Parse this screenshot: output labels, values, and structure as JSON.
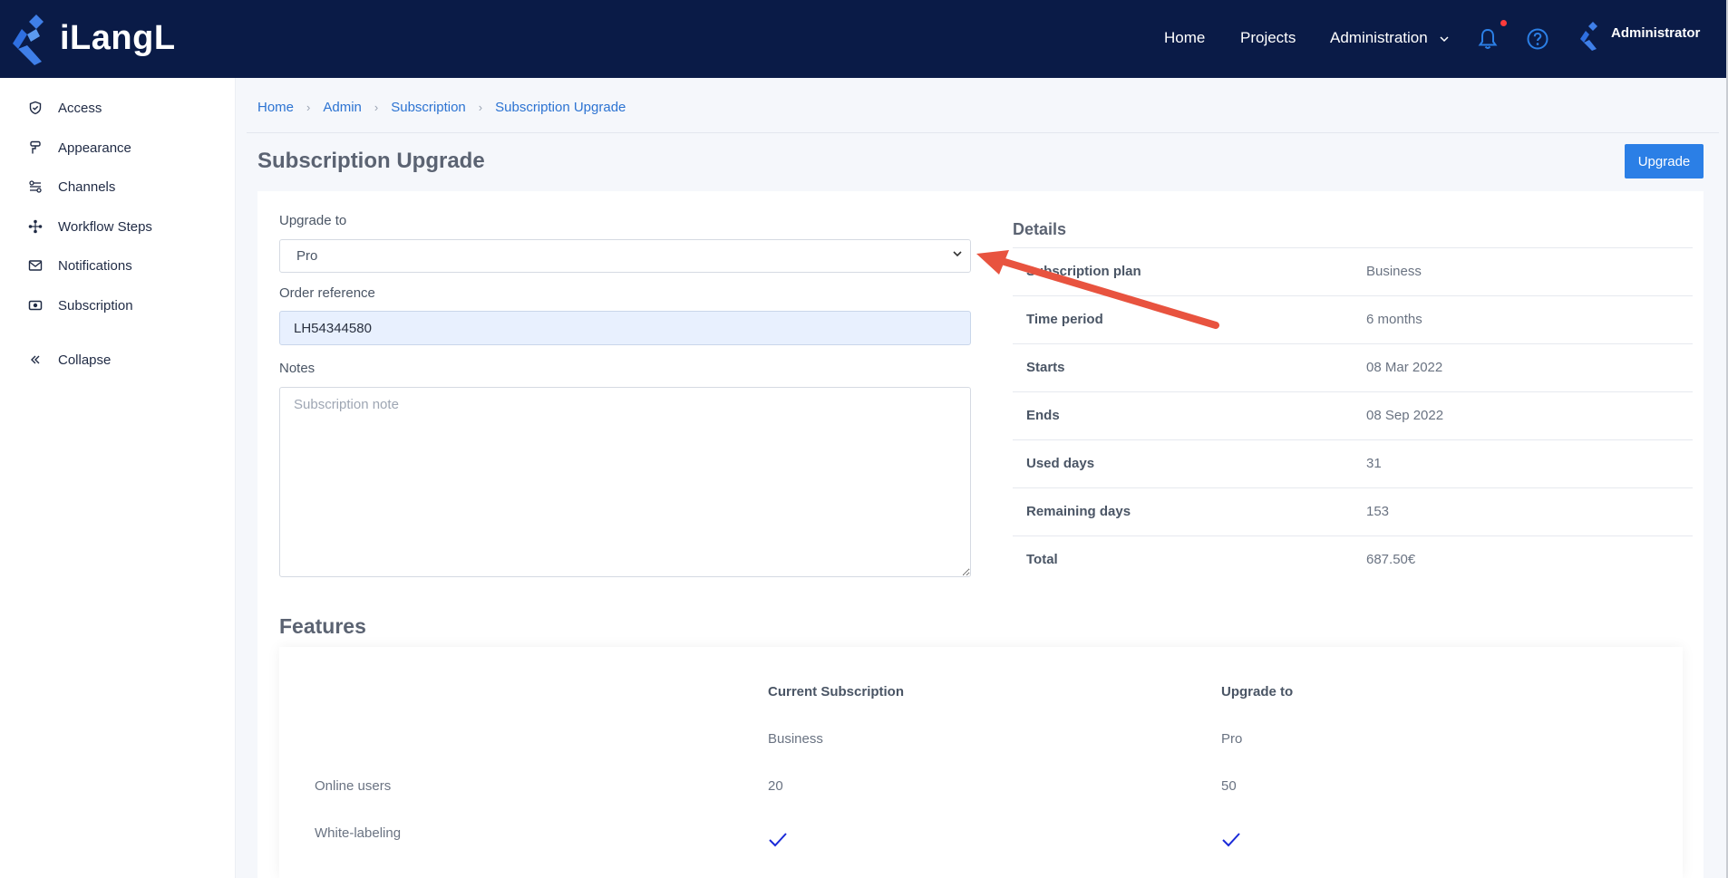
{
  "brand": {
    "name": "iLangL"
  },
  "topnav": {
    "home": "Home",
    "projects": "Projects",
    "administration": "Administration",
    "user_name": "Administrator"
  },
  "sidebar": {
    "items": [
      {
        "label": "Access",
        "icon": "shield-icon"
      },
      {
        "label": "Appearance",
        "icon": "paint-roller-icon"
      },
      {
        "label": "Channels",
        "icon": "channels-icon"
      },
      {
        "label": "Workflow Steps",
        "icon": "workflow-icon"
      },
      {
        "label": "Notifications",
        "icon": "mail-icon"
      },
      {
        "label": "Subscription",
        "icon": "subscription-icon"
      }
    ],
    "collapse": "Collapse"
  },
  "breadcrumb": [
    "Home",
    "Admin",
    "Subscription",
    "Subscription Upgrade"
  ],
  "page": {
    "title": "Subscription Upgrade",
    "upgrade_button": "Upgrade"
  },
  "form": {
    "upgrade_to_label": "Upgrade to",
    "upgrade_to_value": "Pro",
    "order_reference_label": "Order reference",
    "order_reference_value": "LH54344580",
    "notes_label": "Notes",
    "notes_placeholder": "Subscription note"
  },
  "details": {
    "title": "Details",
    "rows": [
      {
        "key": "Subscription plan",
        "value": "Business"
      },
      {
        "key": "Time period",
        "value": "6 months"
      },
      {
        "key": "Starts",
        "value": "08 Mar 2022"
      },
      {
        "key": "Ends",
        "value": "08 Sep 2022"
      },
      {
        "key": "Used days",
        "value": "31"
      },
      {
        "key": "Remaining days",
        "value": "153"
      },
      {
        "key": "Total",
        "value": "687.50€"
      }
    ]
  },
  "features": {
    "title": "Features",
    "columns": [
      "Current Subscription",
      "Upgrade to"
    ],
    "plans": [
      "Business",
      "Pro"
    ],
    "rows": [
      {
        "name": "Online users",
        "current": "20",
        "upgrade": "50"
      },
      {
        "name": "White-labeling",
        "current": "check",
        "upgrade": "check"
      }
    ]
  },
  "colors": {
    "topbar": "#0a1b47",
    "accent": "#2b7fe6",
    "annotation_arrow": "#e8533f"
  }
}
